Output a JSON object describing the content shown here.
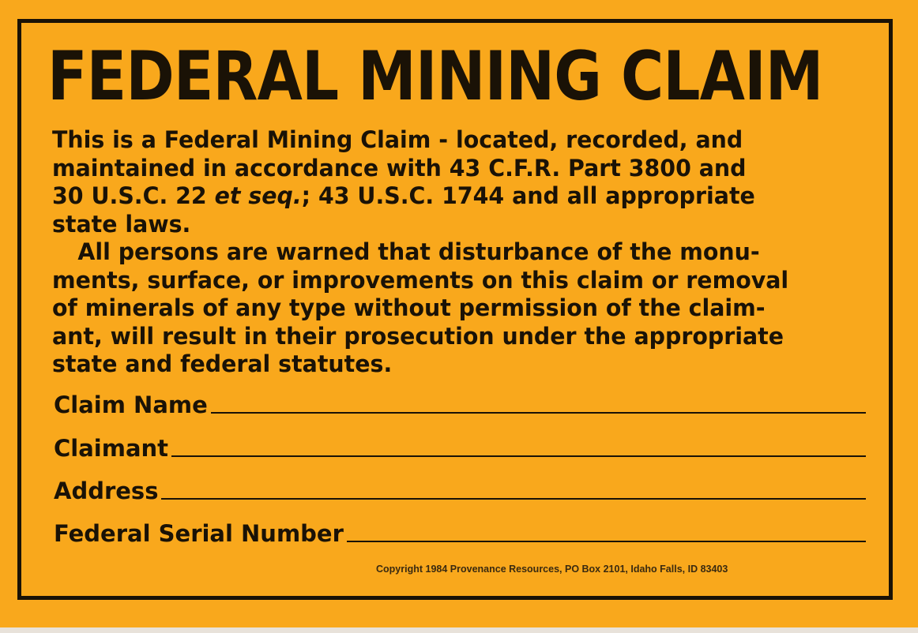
{
  "sign": {
    "title": "FEDERAL MINING CLAIM",
    "paragraph1": [
      "This is a Federal Mining Claim - located, recorded, and",
      "maintained in accordance with 43 C.F.R. Part 3800 and",
      {
        "before": "30 U.S.C. 22 ",
        "italic": "et seq.",
        "after": "; 43 U.S.C. 1744 and all appropriate"
      },
      "state laws."
    ],
    "paragraph2": [
      "All persons are warned that disturbance of the monu-",
      "ments, surface, or improvements on this claim or removal",
      "of minerals of any type without permission of the claim-",
      "ant, will result in their prosecution under the appropriate",
      "state and federal statutes."
    ],
    "fields": {
      "claim_name": "Claim Name",
      "claimant": "Claimant",
      "address": "Address",
      "serial_number": "Federal Serial Number"
    },
    "copyright": "Copyright 1984 Provenance Resources, PO Box 2101, Idaho Falls, ID 83403"
  },
  "colors": {
    "background": "#f9a81c",
    "ink": "#1a1206"
  }
}
